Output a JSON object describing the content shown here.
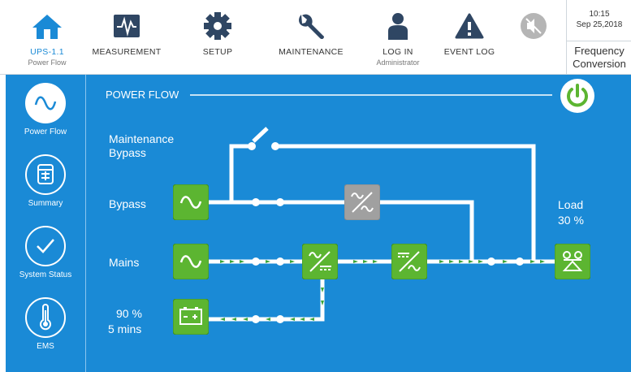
{
  "topbar": {
    "ups": {
      "label": "UPS-1.1",
      "sub": "Power Flow"
    },
    "measurement": {
      "label": "MEASUREMENT"
    },
    "setup": {
      "label": "SETUP"
    },
    "maintenance": {
      "label": "MAINTENANCE"
    },
    "login": {
      "label": "LOG IN",
      "sub": "Administrator"
    },
    "eventlog": {
      "label": "EVENT LOG"
    },
    "clock": {
      "time": "10:15",
      "date": "Sep 25,2018"
    },
    "mode": {
      "line1": "Frequency",
      "line2": "Conversion"
    }
  },
  "sidebar": {
    "items": [
      {
        "label": "Power Flow",
        "icon": "sine-wave-icon",
        "active": true
      },
      {
        "label": "Summary",
        "icon": "summary-icon",
        "active": false
      },
      {
        "label": "System Status",
        "icon": "checkmark-icon",
        "active": false
      },
      {
        "label": "EMS",
        "icon": "thermometer-icon",
        "active": false
      }
    ]
  },
  "diagram": {
    "title": "POWER FLOW",
    "maint_bypass_line1": "Maintenance",
    "maint_bypass_line2": "Bypass",
    "bypass": "Bypass",
    "mains": "Mains",
    "battery_percent": "90 %",
    "battery_time": "5 mins",
    "load_label": "Load",
    "load_value": "30 %"
  },
  "colors": {
    "accent": "#1a8ad6",
    "active_green": "#5cb531",
    "inactive_gray": "#a0a0a0",
    "flow_arrow": "#3aa63a"
  }
}
